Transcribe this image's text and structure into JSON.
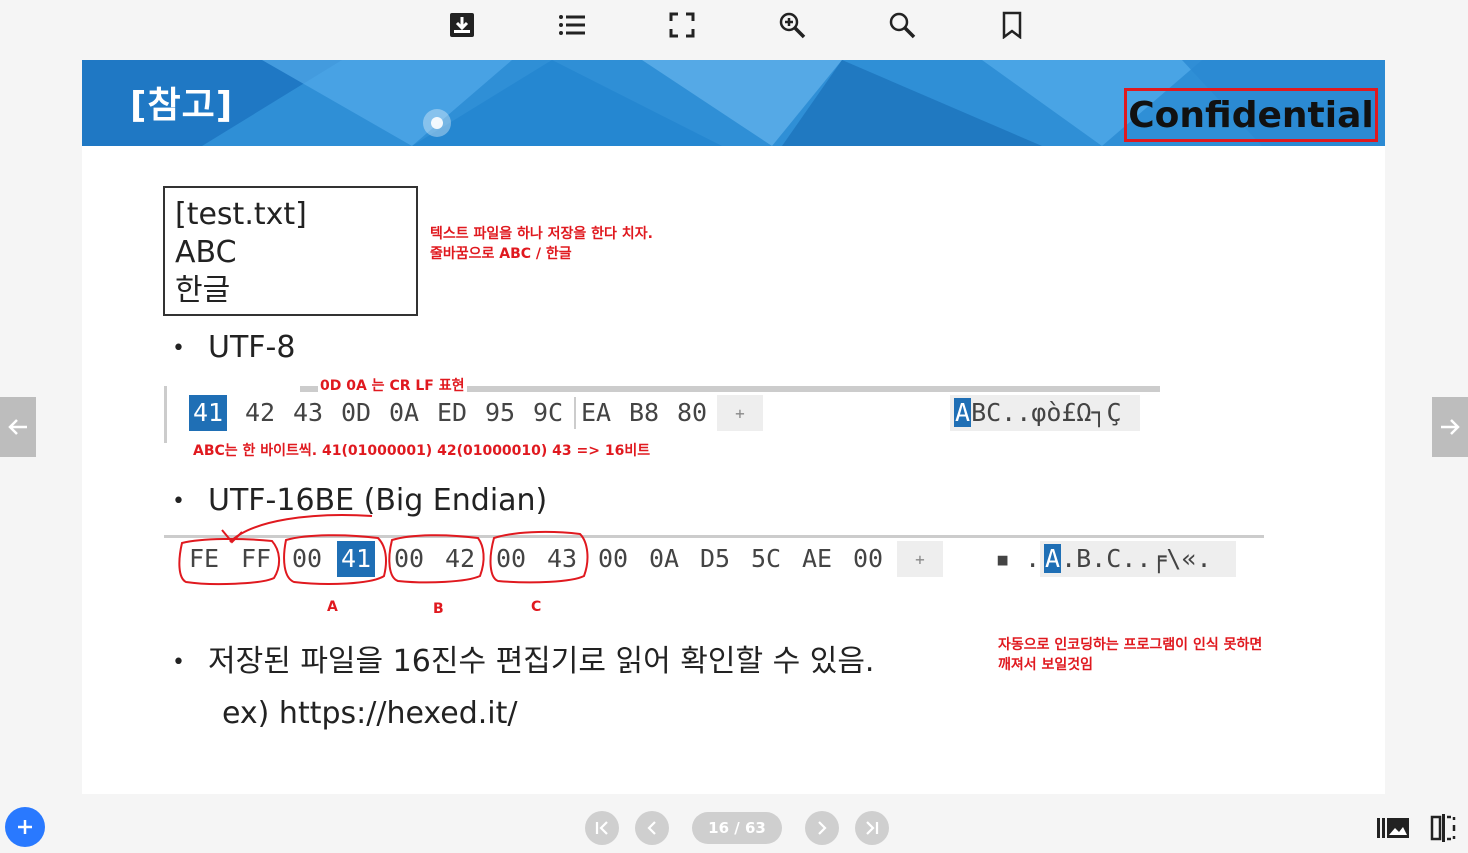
{
  "toolbar": {
    "icons": [
      "download-icon",
      "list-icon",
      "fullscreen-icon",
      "zoom-in-icon",
      "search-icon",
      "bookmark-icon"
    ]
  },
  "slide": {
    "banner_title": "[참고]",
    "confidential": "Confidential",
    "file_box": [
      "[test.txt]",
      "ABC",
      "한글"
    ],
    "note_top": [
      "텍스트 파일을 하나 저장을 한다 치자.",
      "줄바꿈으로 ABC / 한글"
    ],
    "bullet_utf8": "UTF-8",
    "note_crlf": "0D 0A 는 CR LF 표현",
    "utf8_hex": [
      "41",
      "42",
      "43",
      "0D",
      "0A",
      "ED",
      "95",
      "9C",
      "EA",
      "B8",
      "80"
    ],
    "utf8_plus": "+",
    "utf8_ascii_sel": "A",
    "utf8_ascii_rest": "BC..φò£Ω┐Ç",
    "note_abc": "ABC는 한 바이트씩. 41(01000001) 42(01000010) 43 => 16비트",
    "bullet_utf16": "UTF-16BE (Big Endian)",
    "utf16_hex": [
      "FE",
      "FF",
      "00",
      "41",
      "00",
      "42",
      "00",
      "43",
      "00",
      "0A",
      "D5",
      "5C",
      "AE",
      "00"
    ],
    "utf16_plus": "+",
    "utf16_ascii_pre": "▪  .",
    "utf16_ascii_sel": "A",
    "utf16_ascii_rest": ".B.C..╒\\«.",
    "label_a": "A",
    "label_b": "B",
    "label_c": "C",
    "bullet_hex_editor": "저장된 파일을 16진수 편집기로 읽어 확인할 수 있음.",
    "note_decode": [
      "자동으로 인코딩하는 프로그램이 인식 못하면",
      "깨져서 보일것임"
    ],
    "url_line": "ex) https://hexed.it/"
  },
  "pager": {
    "page_indicator": "16 / 63",
    "first": "first-page-icon",
    "prev": "prev-page-icon",
    "next": "next-page-icon",
    "last": "last-page-icon"
  },
  "colors": {
    "accent_red": "#e0191f",
    "banner_blue": "#2f8fd6",
    "selection_blue": "#1f6fb5",
    "fab_blue": "#2979ff"
  }
}
